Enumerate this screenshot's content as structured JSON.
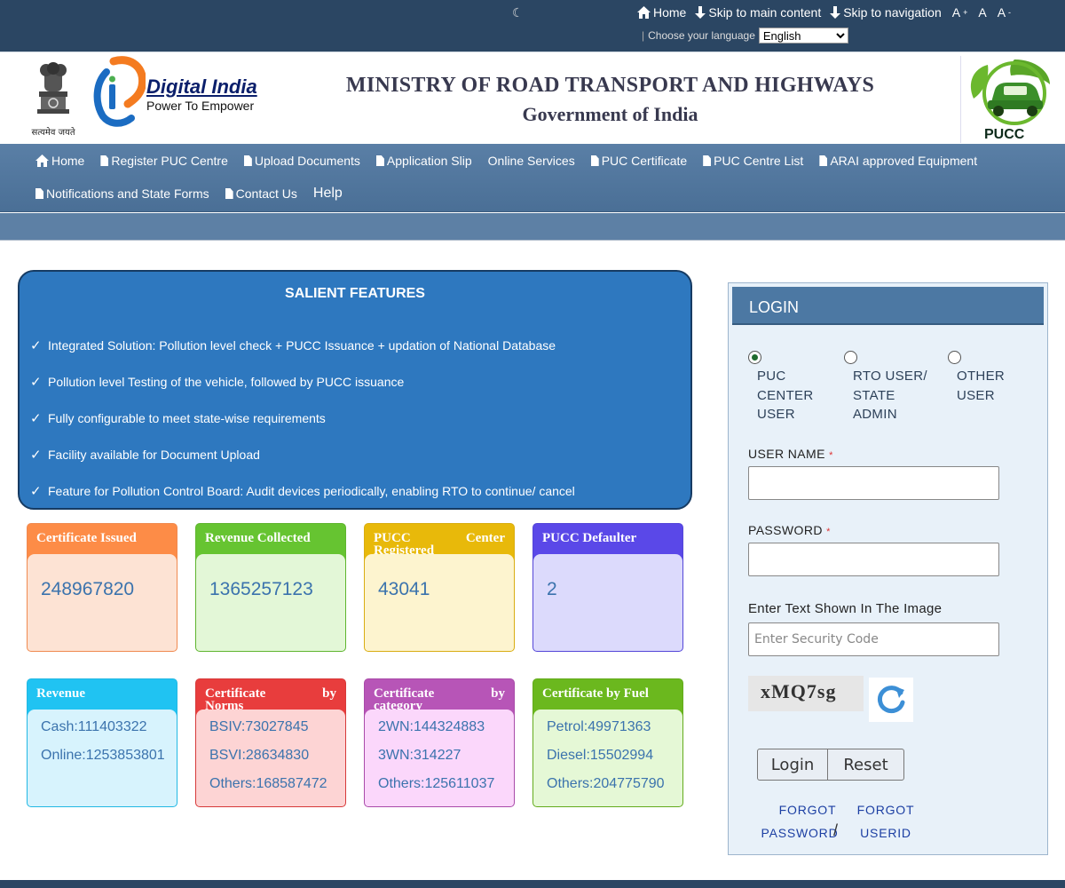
{
  "topbar": {
    "theme_glyph": "☾",
    "home": "Home",
    "skip_main": "Skip to main content",
    "skip_nav": "Skip to navigation",
    "font_plus": "A",
    "font_plus_sup": "+",
    "font_normal": "A",
    "font_minus": "A",
    "font_minus_sup": "-",
    "lang_prompt": "Choose your language",
    "lang_value": "English"
  },
  "header": {
    "emblem_motto": "सत्यमेव जयते",
    "di_title": "Digital India",
    "di_tagline": "Power To Empower",
    "ministry": "MINISTRY OF ROAD TRANSPORT AND HIGHWAYS",
    "government": "Government of India",
    "pucc_logo_text": "PUCC"
  },
  "nav": {
    "row1": [
      "Home",
      "Register PUC Centre",
      "Upload Documents",
      "Application Slip",
      "Online Services",
      "PUC Certificate",
      "PUC Centre List",
      "ARAI approved Equipment"
    ],
    "row2": [
      "Notifications and State Forms",
      "Contact Us",
      "Help"
    ]
  },
  "salient": {
    "title": "SALIENT FEATURES",
    "items": [
      "Integrated Solution: Pollution level check + PUCC Issuance + updation of National Database",
      "Pollution level Testing of the vehicle, followed by PUCC issuance",
      "Fully configurable to meet state-wise requirements",
      "Facility available for Document Upload",
      "Feature for Pollution Control Board: Audit devices periodically, enabling RTO to continue/ cancel"
    ]
  },
  "stats": {
    "certificate_issued": {
      "title": "Certificate Issued",
      "value": "248967820"
    },
    "revenue_collected": {
      "title": "Revenue Collected",
      "value": "1365257123"
    },
    "pucc_registered": {
      "title_a": "PUCC",
      "title_b": "Center",
      "title_c": "Registered",
      "value": "43041"
    },
    "pucc_defaulter": {
      "title": "PUCC Defaulter",
      "value": "2"
    },
    "revenue": {
      "title": "Revenue",
      "lines": [
        "Cash:111403322",
        "Online:1253853801"
      ]
    },
    "cert_norms": {
      "title_a": "Certificate",
      "title_b": "by",
      "title_c": "Norms",
      "lines": [
        "BSIV:73027845",
        "BSVI:28634830",
        "Others:168587472"
      ]
    },
    "cert_category": {
      "title_a": "Certificate",
      "title_b": "by",
      "title_c": "category",
      "lines": [
        "2WN:144324883",
        "3WN:314227",
        "Others:125611037"
      ]
    },
    "cert_fuel": {
      "title": "Certificate by Fuel",
      "lines": [
        "Petrol:49971363",
        "Diesel:15502994",
        "Others:204775790"
      ]
    }
  },
  "login": {
    "title": "LOGIN",
    "roles": [
      {
        "label_lines": [
          "PUC",
          "CENTER",
          "USER"
        ],
        "selected": true
      },
      {
        "label_lines": [
          "RTO USER/",
          "STATE",
          "ADMIN"
        ],
        "selected": false
      },
      {
        "label_lines": [
          "OTHER",
          "USER"
        ],
        "selected": false
      }
    ],
    "username_label": "USER NAME",
    "password_label": "PASSWORD",
    "required_mark": "*",
    "captcha_label": "Enter Text Shown In The Image",
    "captcha_placeholder": "Enter Security Code",
    "captcha_text": "xMQ7sg",
    "login_button": "Login",
    "reset_button": "Reset",
    "forgot_password_a": "FORGOT",
    "forgot_password_b": "PASSWORD",
    "separator": "/",
    "forgot_userid_a": "FORGOT",
    "forgot_userid_b": "USERID"
  },
  "colors": {
    "topbar": "#2b4663",
    "nav": "#4f7499",
    "salient_bg": "#2e78bf",
    "card_orange": "#fd8c47",
    "card_green": "#66c431",
    "card_yellow": "#e8b90a",
    "card_purple": "#5a48e8",
    "card_cyan": "#20c3f2",
    "card_red": "#e83d3d",
    "card_magenta": "#b755b7",
    "card_lime": "#6bb81e"
  }
}
